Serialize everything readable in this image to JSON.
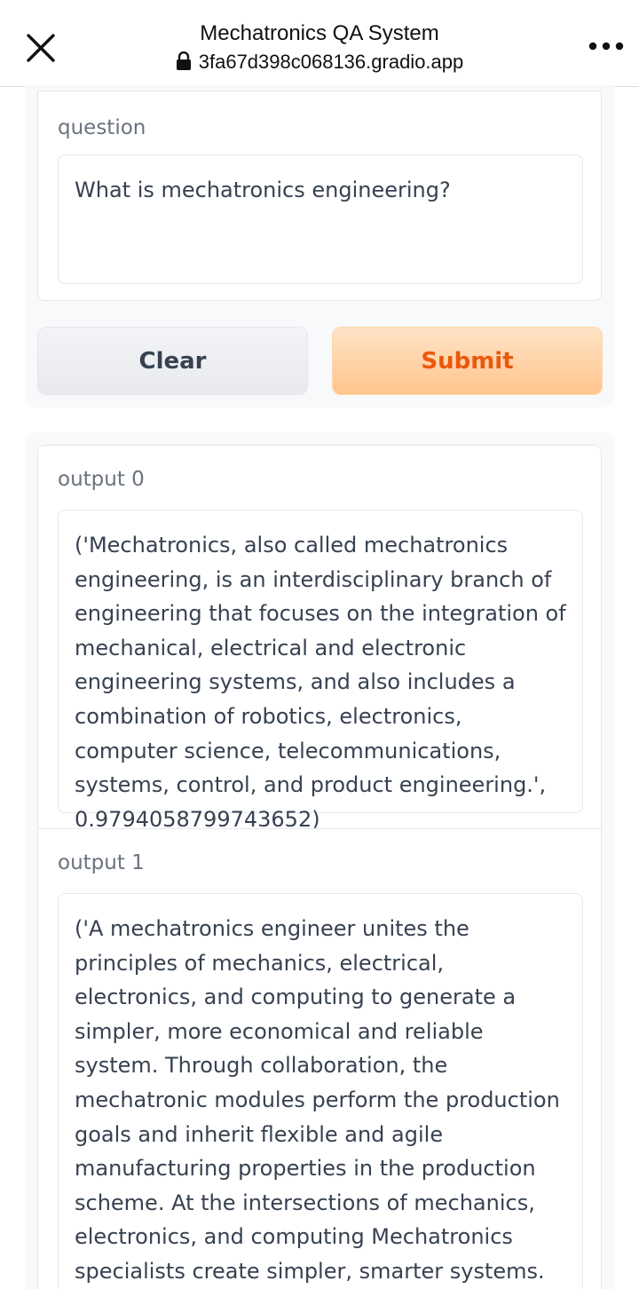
{
  "browser": {
    "title": "Mechatronics QA System",
    "url": "3fa67d398c068136.gradio.app",
    "close_icon": "close-icon",
    "menu_icon": "more-icon",
    "lock_icon": "lock-icon"
  },
  "input": {
    "label": "question",
    "value": "What is mechatronics engineering?"
  },
  "buttons": {
    "clear": "Clear",
    "submit": "Submit"
  },
  "outputs": [
    {
      "label": "output 0",
      "text": "('Mechatronics, also called mechatronics engineering, is an interdisciplinary branch of engineering that focuses on the integration of mechanical, electrical and electronic engineering systems, and also includes a combination of robotics, electronics, computer science, telecommunications, systems, control, and product engineering.', 0.9794058799743652)"
    },
    {
      "label": "output 1",
      "text": "('A mechatronics engineer unites the principles of mechanics, electrical, electronics, and computing to generate a simpler, more economical and reliable system. Through collaboration, the mechatronic modules perform the production goals and inherit flexible and agile manufacturing properties in the production scheme. At the intersections of mechanics, electronics, and computing Mechatronics specialists create simpler, smarter systems. Mechatronics specialists work in the fields of"
    }
  ],
  "colors": {
    "submit_text": "#ea580c",
    "submit_bg": "#ffc58d",
    "panel_bg": "#f8f9fa"
  }
}
